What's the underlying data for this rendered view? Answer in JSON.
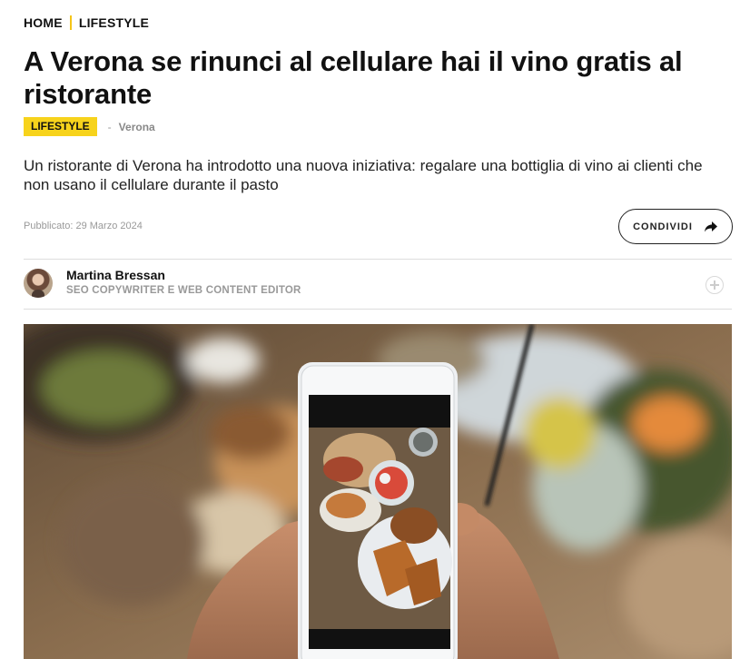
{
  "breadcrumb": {
    "home": "HOME",
    "section": "LIFESTYLE"
  },
  "article": {
    "title": "A Verona se rinunci al cellulare hai il vino gratis al ristorante",
    "tag": "LIFESTYLE",
    "separator": "-",
    "location": "Verona",
    "lead": "Un ristorante di Verona ha introdotto una nuova iniziativa: regalare una bottiglia di vino ai clienti che non usano il cellulare durante il pasto",
    "published": "Pubblicato: 29 Marzo 2024"
  },
  "share": {
    "label": "CONDIVIDI",
    "icon": "share-arrow-icon"
  },
  "author": {
    "name": "Martina Bressan",
    "role": "SEO COPYWRITER E WEB CONTENT EDITOR",
    "follow_icon": "plus-circle-icon"
  },
  "hero": {
    "description_icon": "hero-image"
  },
  "colors": {
    "accent": "#f7d31c",
    "text": "#111111",
    "muted": "#999999"
  }
}
